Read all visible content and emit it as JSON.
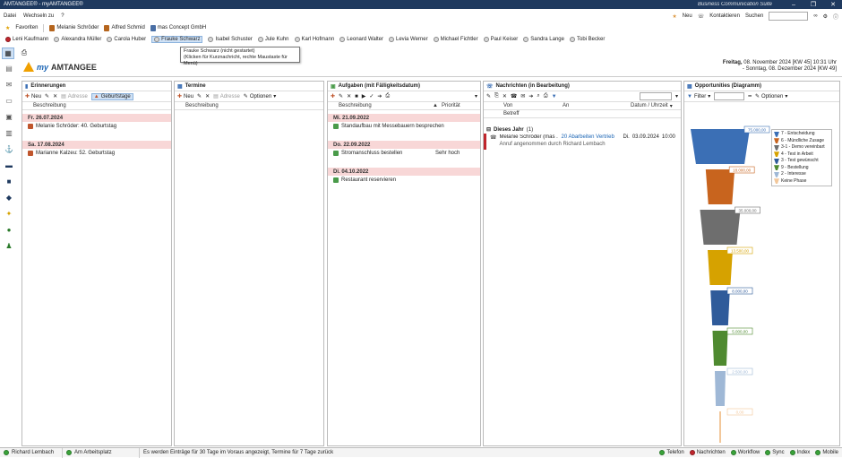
{
  "window": {
    "title": "AMTANGEE® - myAMTANGEE®",
    "suite": "Business Communication Suite"
  },
  "menu": {
    "items": [
      "Datei",
      "Wechseln zu",
      "?"
    ],
    "new_label": "Neu",
    "contacts_label": "Kontaktieren",
    "search_label": "Suchen"
  },
  "favorites": {
    "label": "Favoriten",
    "people": [
      "Melanie Schröder",
      "Alfred Schmid",
      "mas Concept GmbH"
    ]
  },
  "contacts": [
    "Leni Kaufmann",
    "Alexandra Müller",
    "Carola Huber",
    "Frauke Schwarz",
    "Isabel Schuster",
    "Jule Kuhn",
    "Karl Hofmann",
    "Leonard Walter",
    "Levia Werner",
    "Michael Fichtler",
    "Paul Keiser",
    "Sandra Lange",
    "Tobi Becker"
  ],
  "tooltip": {
    "line1": "Frauke Schwarz (nicht gestartet)",
    "line2": "(Klicken für Kurznachricht, rechte Maustaste für Menü)"
  },
  "header": {
    "logo_my": "my",
    "logo_name": "AMTANGEE",
    "day": "Freitag,",
    "date_line1": "08. November 2024 [KW 45] 10:31 Uhr",
    "day2": "- Sonntag,",
    "date_line2": "08. Dezember 2024 [KW 49]"
  },
  "panels": {
    "erinnerungen": {
      "title": "Erinnerungen",
      "new": "Neu",
      "adresse": "Adresse",
      "geburtstage": "Geburtstage",
      "col": "Beschreibung",
      "groups": [
        {
          "date": "Fr. 26.07.2024",
          "items": [
            "Melanie Schröder: 40. Geburtstag"
          ]
        },
        {
          "date": "Sa. 17.08.2024",
          "items": [
            "Marianne Kalzeu: 52. Geburtstag"
          ]
        }
      ]
    },
    "termine": {
      "title": "Termine",
      "new": "Neu",
      "adresse": "Adresse",
      "optionen": "Optionen",
      "col": "Beschreibung"
    },
    "aufgaben": {
      "title": "Aufgaben (mit Fälligkeitsdatum)",
      "col": "Beschreibung",
      "col2": "Priorität",
      "groups": [
        {
          "date": "Mi. 21.09.2022",
          "items": [
            {
              "text": "Standaufbau mit Messebauern besprechen",
              "prio": ""
            }
          ]
        },
        {
          "date": "Do. 22.09.2022",
          "items": [
            {
              "text": "Stromanschluss bestellen",
              "prio": "Sehr hoch"
            }
          ]
        },
        {
          "date": "Di. 04.10.2022",
          "items": [
            {
              "text": "Restaurant reservieren",
              "prio": ""
            }
          ]
        }
      ]
    },
    "nachrichten": {
      "title": "Nachrichten (in Bearbeitung)",
      "col_von": "Von",
      "col_an": "An",
      "col_datum": "Datum / Uhrzeit",
      "col_betreff": "Betreff",
      "group": "Dieses Jahr",
      "group_count": "(1)",
      "msg": {
        "von": "Melanie Schröder (mas ...",
        "an": "20 Abarbeiten Vertrieb",
        "day": "Di.",
        "date": "03.09.2024",
        "time": "10:00",
        "betreff": "Anruf angenommen durch Richard Lembach"
      }
    },
    "opportunities": {
      "title": "Opportunities (Diagramm)",
      "filter": "Filter",
      "optionen": "Optionen"
    }
  },
  "chart_data": {
    "type": "funnel",
    "values": [
      75000,
      18000,
      35000,
      13500,
      8000,
      5000,
      2500,
      0
    ],
    "labels": [
      "75.000,00",
      "18.000,00",
      "35.000,00",
      "13.500,00",
      "8.000,00",
      "5.000,00",
      "2.500,00",
      "0,00"
    ],
    "legend": [
      {
        "name": "7 - Entscheidung",
        "color": "#3b6fb5"
      },
      {
        "name": "6 - Mündliche Zusage",
        "color": "#c8641e"
      },
      {
        "name": "3-1 - Demo vereinbart",
        "color": "#6e6e6e"
      },
      {
        "name": "4 - Test in Arbeit",
        "color": "#d6a200"
      },
      {
        "name": "3 - Test gewünscht",
        "color": "#2f5b9a"
      },
      {
        "name": "9 - Bestellung",
        "color": "#4f8a30"
      },
      {
        "name": "2 - Interesse",
        "color": "#9fb8d6"
      },
      {
        "name": "Keine Phase",
        "color": "#f2c79a"
      }
    ]
  },
  "status": {
    "user": "Richard Lembach",
    "place": "Am Arbeitsplatz",
    "info": "Es werden Einträge für 30 Tage im Voraus angezeigt, Termine für 7 Tage zurück",
    "indicators": [
      "Telefon",
      "Nachrichten",
      "Workflow",
      "Sync",
      "Index",
      "Mobile"
    ]
  }
}
